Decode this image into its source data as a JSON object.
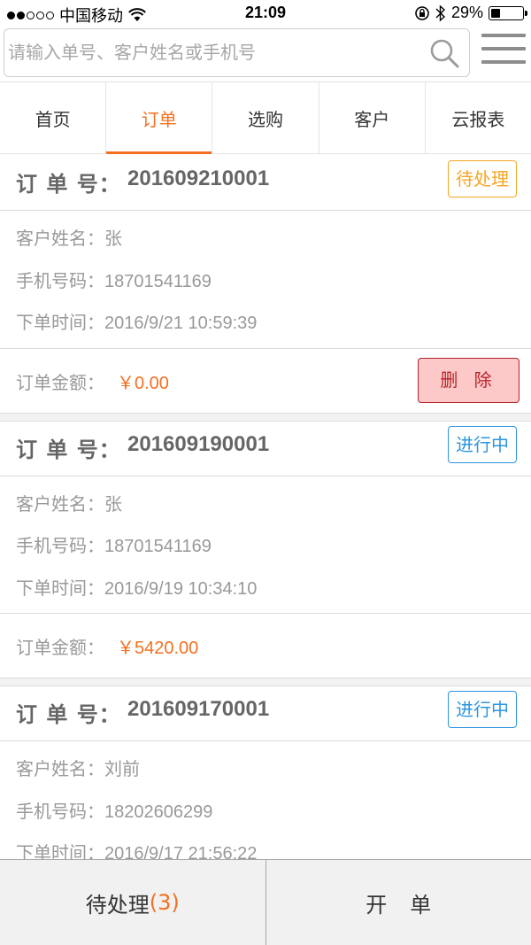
{
  "status_bar": {
    "carrier": "中国移动",
    "time": "21:09",
    "battery": "29%",
    "battery_level": 0.29,
    "signal_full": 2,
    "signal_total": 5
  },
  "search": {
    "placeholder": "请输入单号、客户姓名或手机号"
  },
  "tabs": [
    {
      "label": "首页",
      "active": false
    },
    {
      "label": "订单",
      "active": true
    },
    {
      "label": "选购",
      "active": false
    },
    {
      "label": "客户",
      "active": false
    },
    {
      "label": "云报表",
      "active": false
    }
  ],
  "labels": {
    "order_no": "订 单 号：",
    "customer": "客户姓名：",
    "phone": "手机号码：",
    "time": "下单时间：",
    "amount": "订单金额：",
    "delete": "删 除"
  },
  "orders": [
    {
      "order_no": "201609210001",
      "status": "待处理",
      "status_type": "pending",
      "customer": "张",
      "phone": "18701541169",
      "time": "2016/9/21 10:59:39",
      "amount": "￥0.00",
      "deletable": true
    },
    {
      "order_no": "201609190001",
      "status": "进行中",
      "status_type": "progress",
      "customer": "张",
      "phone": "18701541169",
      "time": "2016/9/19 10:34:10",
      "amount": "￥5420.00",
      "deletable": false
    },
    {
      "order_no": "201609170001",
      "status": "进行中",
      "status_type": "progress",
      "customer": "刘前",
      "phone": "18202606299",
      "time": "2016/9/17 21:56:22",
      "amount": "",
      "deletable": false
    }
  ],
  "bottom_bar": {
    "pending_label": "待处理",
    "pending_count": "(3)",
    "new_order_label": "开单"
  },
  "colors": {
    "accent": "#f37021",
    "pending": "#f5a623",
    "progress": "#2d95e0",
    "delete": "#b4242a"
  }
}
